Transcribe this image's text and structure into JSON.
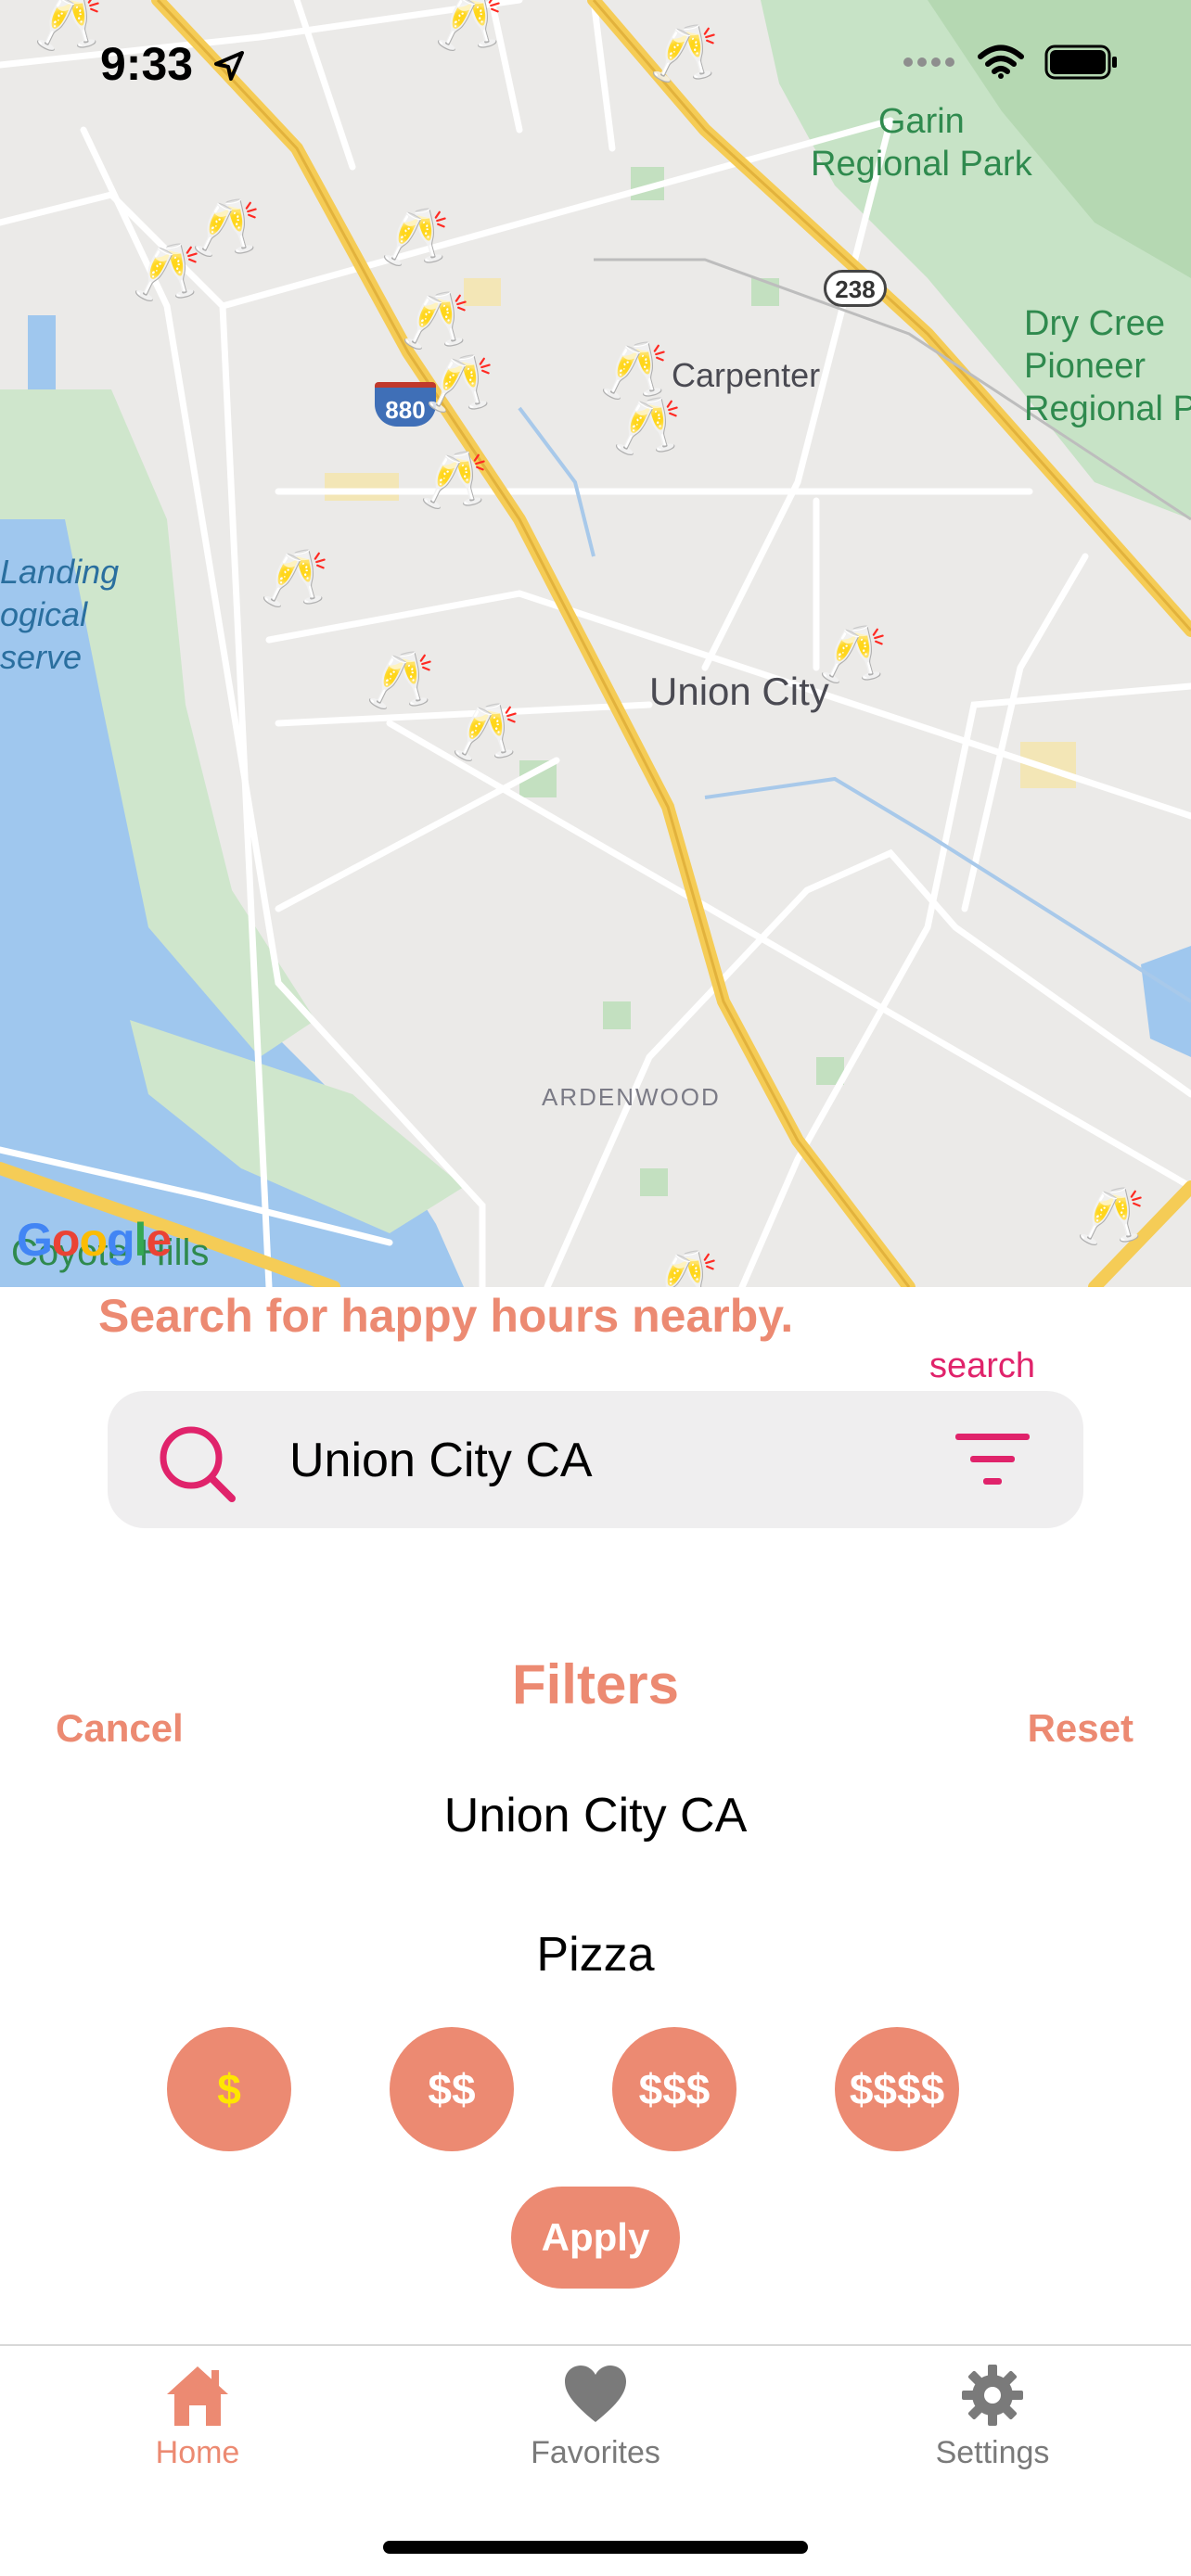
{
  "status_bar": {
    "time": "9:33",
    "icons": [
      "location-arrow-icon",
      "cellular-icon",
      "wifi-icon",
      "battery-icon"
    ]
  },
  "map": {
    "labels": {
      "garin_park": "Garin\nRegional Park",
      "dry_creek": "Dry Cree\nPioneer\nRegional P",
      "carpenter": "Carpenter",
      "union_city": "Union City",
      "ardenwood": "ARDENWOOD",
      "landing": "Landing\nogical\nserve",
      "coyote_hills": "Coyote Hills"
    },
    "highway_shields": [
      "238",
      "880"
    ],
    "marker_icon": "champagne-glasses-icon",
    "google_logo": "Google"
  },
  "search": {
    "heading": "Search for happy hours nearby.",
    "small_label": "search",
    "value": "Union City CA",
    "placeholder": "Search"
  },
  "filters": {
    "title": "Filters",
    "cancel_label": "Cancel",
    "reset_label": "Reset",
    "location": "Union City CA",
    "category": "Pizza",
    "price_levels": [
      "$",
      "$$",
      "$$$",
      "$$$$"
    ],
    "selected_price": "$",
    "apply_label": "Apply"
  },
  "tabs": [
    {
      "label": "Home",
      "icon": "home-icon",
      "active": true
    },
    {
      "label": "Favorites",
      "icon": "heart-icon",
      "active": false
    },
    {
      "label": "Settings",
      "icon": "gear-icon",
      "active": false
    }
  ],
  "colors": {
    "accent": "#ec8a72",
    "search_icon": "#e0236b",
    "selected_price_text": "#ffe600",
    "inactive_tab": "#7a7a7a"
  }
}
